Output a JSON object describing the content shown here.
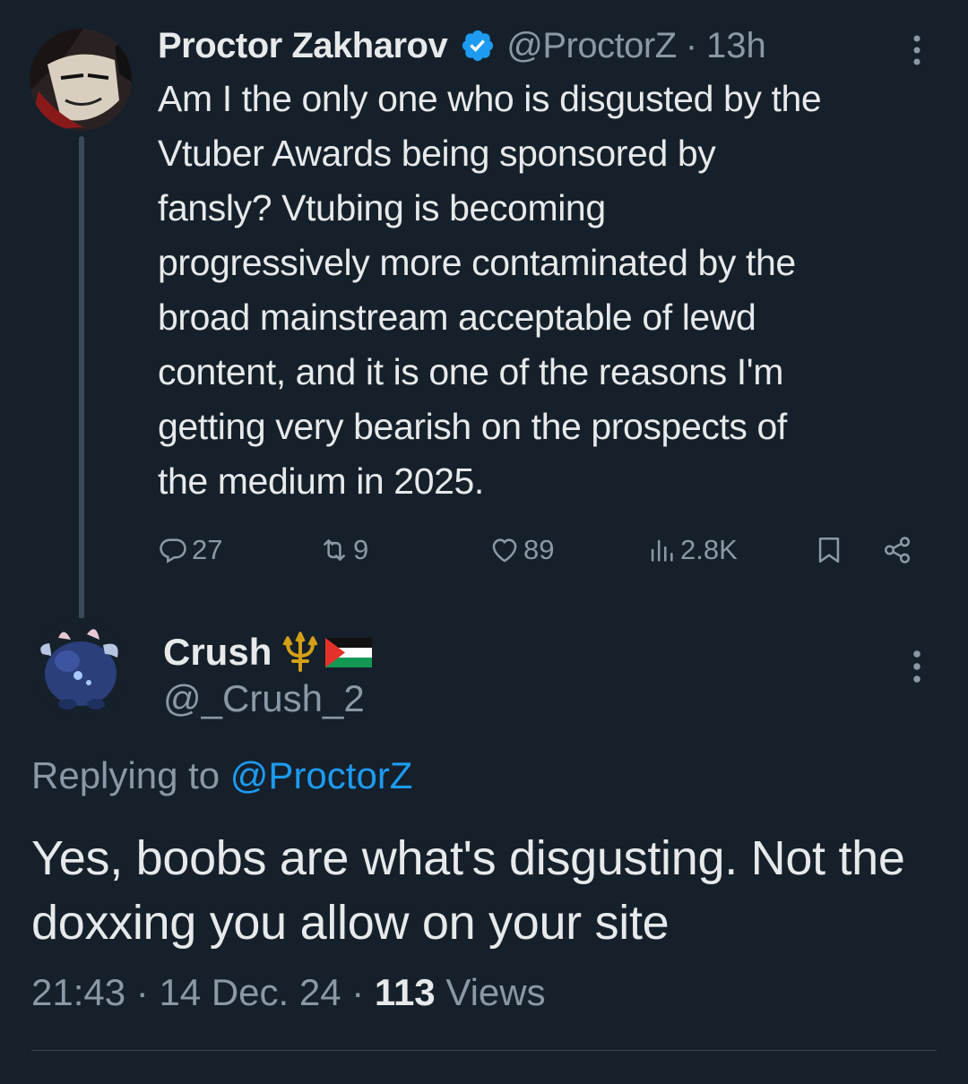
{
  "parent_tweet": {
    "display_name": "Proctor Zakharov",
    "handle": "@ProctorZ",
    "separator": "·",
    "time": "13h",
    "text": "Am I the only one who is disgusted by the\nVtuber Awards being sponsored by\nfansly? Vtubing is becoming\nprogressively more contaminated by the\nbroad mainstream acceptable of lewd\ncontent, and it is one of the reasons I'm\ngetting very bearish on the prospects of\nthe medium in 2025.",
    "stats": {
      "replies": "27",
      "reposts": "9",
      "likes": "89",
      "views": "2.8K"
    }
  },
  "reply_tweet": {
    "display_name": "Crush",
    "handle": "@_Crush_2",
    "replying_prefix": "Replying to ",
    "replying_to": "@ProctorZ",
    "text": "Yes, boobs are what's disgusting. Not the doxxing you allow on your site",
    "time": "21:43",
    "date": "14 Dec. 24",
    "separator": " · ",
    "views_count": "113",
    "views_label": " Views"
  },
  "colors": {
    "background": "#15202b",
    "text_primary": "#e7e9ea",
    "text_secondary": "#8b98a5",
    "accent": "#1d9bf0",
    "thread_line": "#3c4a57"
  },
  "icons": {
    "verified": "verified-badge-icon",
    "more": "more-vertical-icon",
    "reply": "reply-icon",
    "repost": "repost-icon",
    "like": "heart-icon",
    "views": "views-chart-icon",
    "bookmark": "bookmark-icon",
    "share": "share-icon",
    "trident_emoji": "trident-emoji-icon",
    "flag_emoji": "palestine-flag-emoji-icon"
  }
}
